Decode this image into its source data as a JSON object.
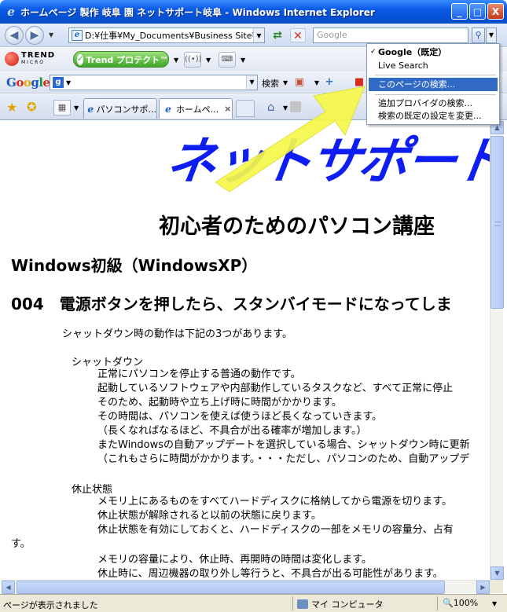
{
  "window": {
    "title": "ホームページ 製作 岐阜 園 ネットサポート岐阜 - Windows Internet Explorer",
    "minimize": "_",
    "maximize": "□",
    "close": "X"
  },
  "address_bar": {
    "value": "D:¥仕事¥My_Documents¥Business Site¥c"
  },
  "search_box": {
    "placeholder": "Google"
  },
  "trend_toolbar": {
    "logo_text": "TREND",
    "logo_sub": "MICRO",
    "protect_label": "Trend プロテクト™"
  },
  "google_toolbar": {
    "search_label": "検索"
  },
  "tabs": [
    {
      "label": "パソコンサポ..."
    },
    {
      "label": "ホームペ...",
      "close": "×"
    }
  ],
  "content": {
    "banner": "ネットサポート岐",
    "subtitle": "初心者のためのパソコン講座",
    "heading_level": "Windows初級（WindowsXP）",
    "heading_topic": "004　電源ボタンを押したら、スタンバイモードになってしま",
    "intro": "シャットダウン時の動作は下記の3つがあります。",
    "sections": [
      {
        "title": "シャットダウン",
        "lines": [
          "正常にパソコンを停止する普通の動作です。",
          "起動しているソフトウェアや内部動作しているタスクなど、すべて正常に停止",
          "そのため、起動時や立ち上げ時に時間がかかります。",
          "その時間は、パソコンを使えば使うほど長くなっていきます。",
          "（長くなればなるほど、不具合が出る確率が増加します。）",
          "またWindowsの自動アップデートを選択している場合、シャットダウン時に更新",
          "（これもさらに時間がかかります。・・・ただし、パソコンのため、自動アップデ"
        ]
      },
      {
        "title": "休止状態",
        "lines": [
          "メモリ上にあるものをすべてハードディスクに格納してから電源を切ります。",
          "休止状態が解除されると以前の状態に戻ります。",
          "休止状態を有効にしておくと、ハードディスクの一部をメモリの容量分、占有",
          "す。",
          "メモリの容量により、休止時、再開時の時間は変化します。",
          "休止時に、周辺機器の取り外し等行うと、不具合が出る可能性があります。"
        ]
      }
    ]
  },
  "search_menu": {
    "items": [
      {
        "label": "Google（既定）",
        "checked": true,
        "bold": true
      },
      {
        "label": "Live Search"
      },
      {
        "label": "このページの検索...",
        "selected": true
      },
      {
        "label": "追加プロバイダの検索..."
      },
      {
        "label": "検索の既定の設定を変更..."
      }
    ]
  },
  "status_bar": {
    "text": "ページが表示されました",
    "zone": "マイ コンピュータ",
    "zoom": "100%"
  },
  "colors": {
    "title_bar": "#0a5ae6",
    "banner_text": "#0e1ef2",
    "arrow": "#f6f84a",
    "menu_highlight": "#316ac5"
  }
}
